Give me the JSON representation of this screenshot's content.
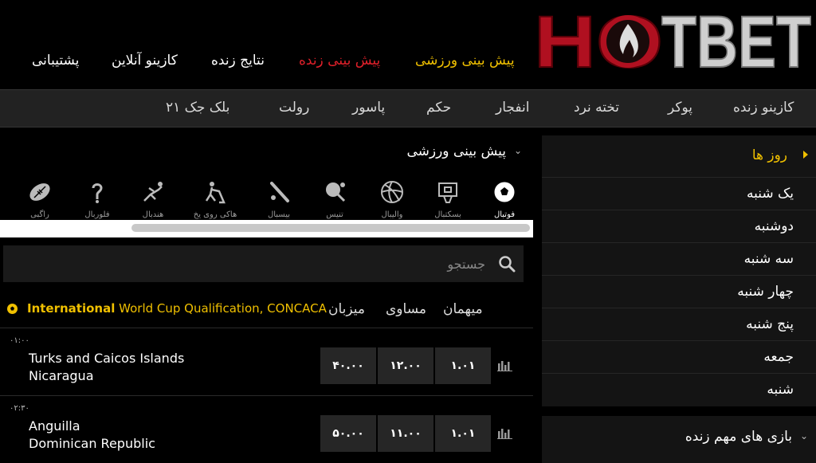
{
  "header": {
    "logo_text": "HOTBET",
    "nav": [
      {
        "label": "پیش بینی ورزشی",
        "color": "#f0c000"
      },
      {
        "label": "پیش بینی زنده",
        "color": "#e0202a"
      },
      {
        "label": "نتایج زنده",
        "color": "#ffffff"
      },
      {
        "label": "کازینو آنلاین",
        "color": "#ffffff"
      },
      {
        "label": "پشتیبانی",
        "color": "#ffffff"
      }
    ]
  },
  "subnav": [
    "کازینو زنده",
    "پوکر",
    "تخته نرد",
    "انفجار",
    "حکم",
    "پاسور",
    "رولت",
    "بلک جک ۲۱"
  ],
  "days": {
    "title": "روز ها",
    "items": [
      "یک شنبه",
      "دوشنبه",
      "سه شنبه",
      "چهار شنبه",
      "پنج شنبه",
      "جمعه",
      "شنبه"
    ]
  },
  "important": {
    "title": "بازی های مهم زنده"
  },
  "sports": {
    "title": "پیش بینی ورزشی",
    "items": [
      {
        "label": "فوتبال",
        "icon": "soccer-icon",
        "active": true
      },
      {
        "label": "بسکتبال",
        "icon": "basketball-icon"
      },
      {
        "label": "والیبال",
        "icon": "volleyball-icon"
      },
      {
        "label": "تنیس",
        "icon": "tennis-icon"
      },
      {
        "label": "بیسبال",
        "icon": "baseball-icon"
      },
      {
        "label": "هاکی روی یخ",
        "icon": "ice-hockey-icon"
      },
      {
        "label": "هندبال",
        "icon": "handball-icon"
      },
      {
        "label": "فلوربال",
        "icon": "floorball-icon"
      },
      {
        "label": "راگبی",
        "icon": "rugby-icon"
      }
    ]
  },
  "search": {
    "placeholder": "جستجو"
  },
  "league": {
    "prefix": "International",
    "name": "World Cup Qualification, CONCACA"
  },
  "columns": {
    "host": "میزبان",
    "draw": "مساوی",
    "guest": "میهمان"
  },
  "matches": [
    {
      "time": "۰۱:۰۰",
      "home": "Turks and Caicos Islands",
      "away": "Nicaragua",
      "odds": [
        "۴۰.۰۰",
        "۱۲.۰۰",
        "۱.۰۱"
      ]
    },
    {
      "time": "۰۲:۳۰",
      "home": "Anguilla",
      "away": "Dominican Republic",
      "odds": [
        "۵۰.۰۰",
        "۱۱.۰۰",
        "۱.۰۱"
      ]
    }
  ]
}
